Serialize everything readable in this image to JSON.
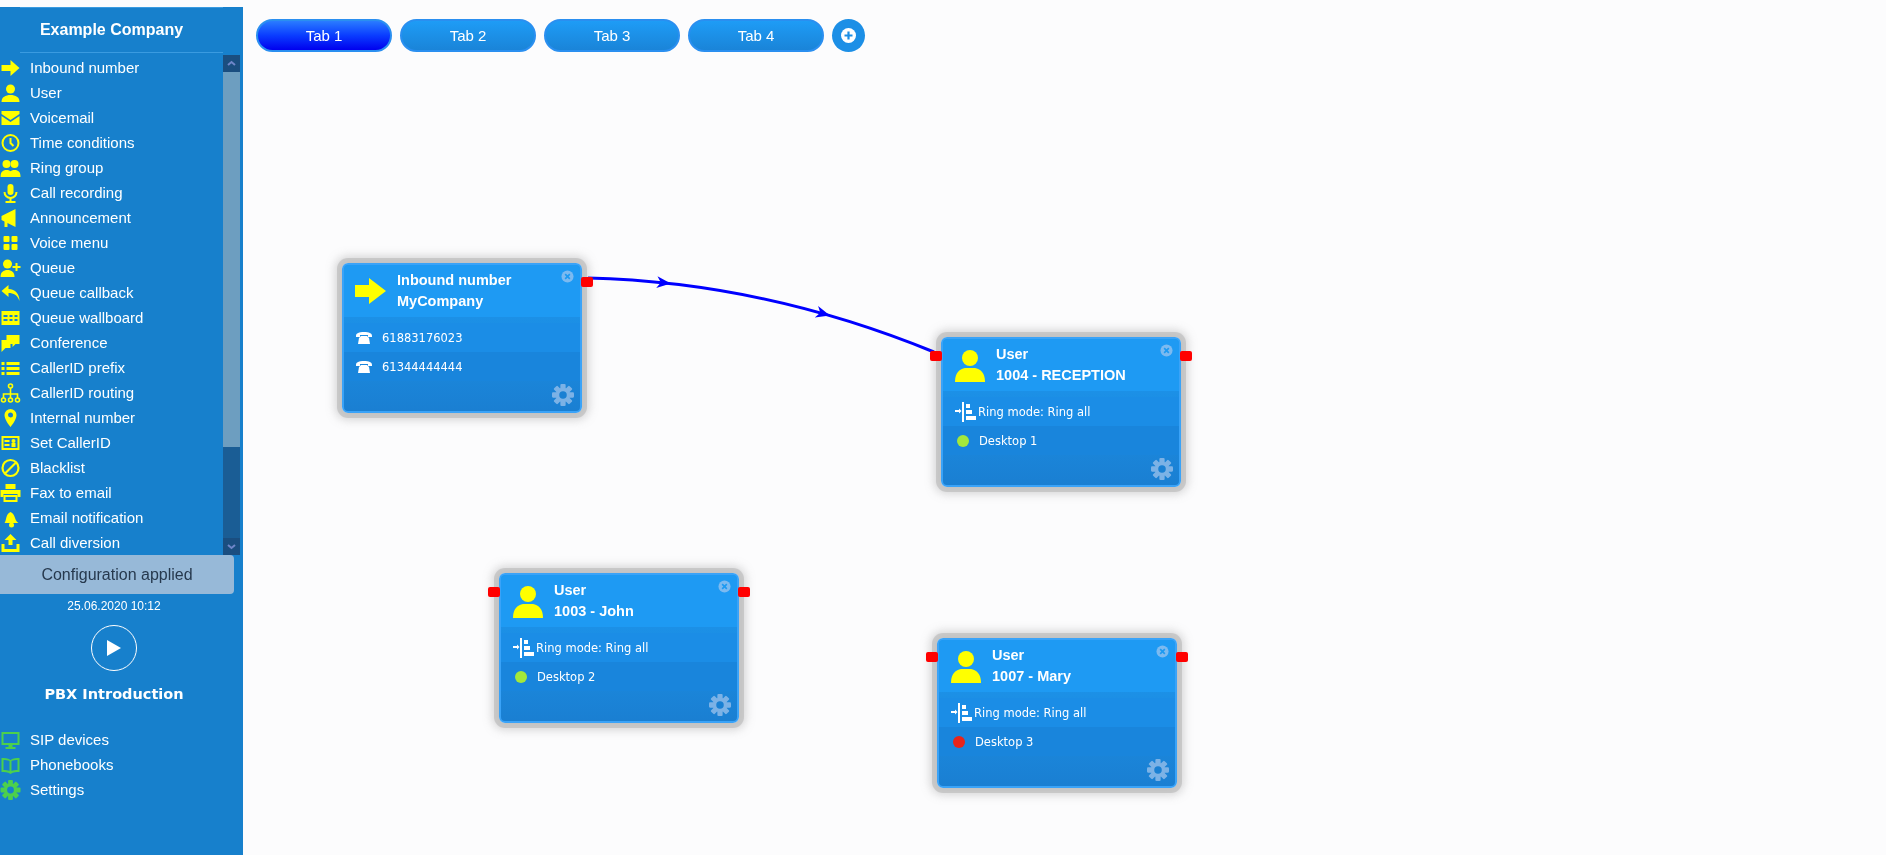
{
  "sidebar": {
    "company": "Example Company",
    "items": [
      {
        "label": "Inbound number"
      },
      {
        "label": "User"
      },
      {
        "label": "Voicemail"
      },
      {
        "label": "Time conditions"
      },
      {
        "label": "Ring group"
      },
      {
        "label": "Call recording"
      },
      {
        "label": "Announcement"
      },
      {
        "label": "Voice menu"
      },
      {
        "label": "Queue"
      },
      {
        "label": "Queue callback"
      },
      {
        "label": "Queue wallboard"
      },
      {
        "label": "Conference"
      },
      {
        "label": "CallerID prefix"
      },
      {
        "label": "CallerID routing"
      },
      {
        "label": "Internal number"
      },
      {
        "label": "Set CallerID"
      },
      {
        "label": "Blacklist"
      },
      {
        "label": "Fax to email"
      },
      {
        "label": "Email notification"
      },
      {
        "label": "Call diversion"
      }
    ],
    "status": "Configuration applied",
    "timestamp": "25.06.2020 10:12",
    "intro_label": "PBX Introduction",
    "bottom_items": [
      {
        "label": "SIP devices"
      },
      {
        "label": "Phonebooks"
      },
      {
        "label": "Settings"
      }
    ]
  },
  "tabs": [
    {
      "label": "Tab 1",
      "selected": true
    },
    {
      "label": "Tab 2",
      "selected": false
    },
    {
      "label": "Tab 3",
      "selected": false
    },
    {
      "label": "Tab 4",
      "selected": false
    }
  ],
  "nodes": [
    {
      "kind": "inbound",
      "title": "Inbound number",
      "subtitle": "MyCompany",
      "numbers": [
        "61883176023",
        "61344444444"
      ]
    },
    {
      "kind": "user",
      "title": "User",
      "subtitle": "1004 - RECEPTION",
      "ring_mode": "Ring mode: Ring all",
      "device": {
        "label": "Desktop 1",
        "color": "#a4e83a"
      }
    },
    {
      "kind": "user",
      "title": "User",
      "subtitle": "1003 - John",
      "ring_mode": "Ring mode: Ring all",
      "device": {
        "label": "Desktop 2",
        "color": "#a4e83a"
      }
    },
    {
      "kind": "user",
      "title": "User",
      "subtitle": "1007 - Mary",
      "ring_mode": "Ring mode: Ring all",
      "device": {
        "label": "Desktop 3",
        "color": "#e8241a"
      }
    }
  ]
}
